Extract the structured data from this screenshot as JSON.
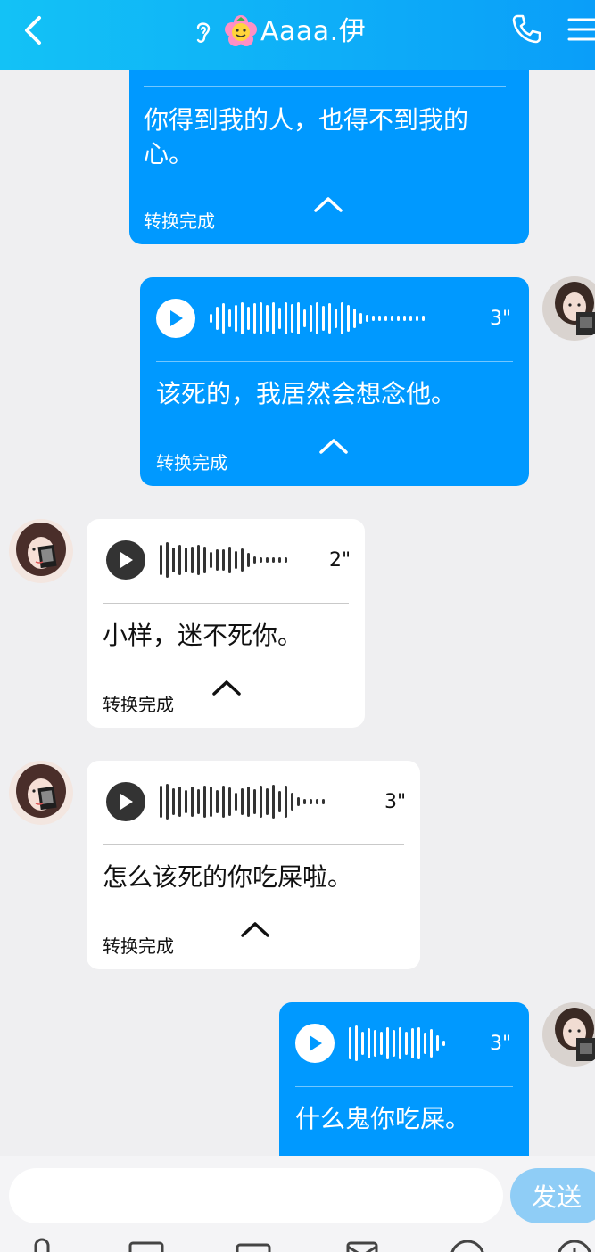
{
  "header": {
    "title": "Aaaa.伊",
    "icons": [
      "back-icon",
      "ear-icon",
      "flower-icon",
      "phone-icon",
      "menu-icon"
    ]
  },
  "messages": [
    {
      "side": "sent",
      "text": "你得到我的人，也得不到我的心。",
      "status": "转换完成"
    },
    {
      "side": "sent",
      "duration": "3\"",
      "text": "该死的，我居然会想念他。",
      "status": "转换完成"
    },
    {
      "side": "received",
      "duration": "2\"",
      "text": "小样，迷不死你。",
      "status": "转换完成"
    },
    {
      "side": "received",
      "duration": "3\"",
      "text": "怎么该死的你吃屎啦。",
      "status": "转换完成"
    },
    {
      "side": "sent",
      "duration": "3\"",
      "text": "什么鬼你吃屎。"
    }
  ],
  "composer": {
    "placeholder": "",
    "send_label": "发送"
  },
  "colors": {
    "header_start": "#13c2f6",
    "header_end": "#0a9ef9",
    "sent_bubble": "#0099ff",
    "received_bubble": "#ffffff",
    "send_button": "#8fcdf6"
  }
}
